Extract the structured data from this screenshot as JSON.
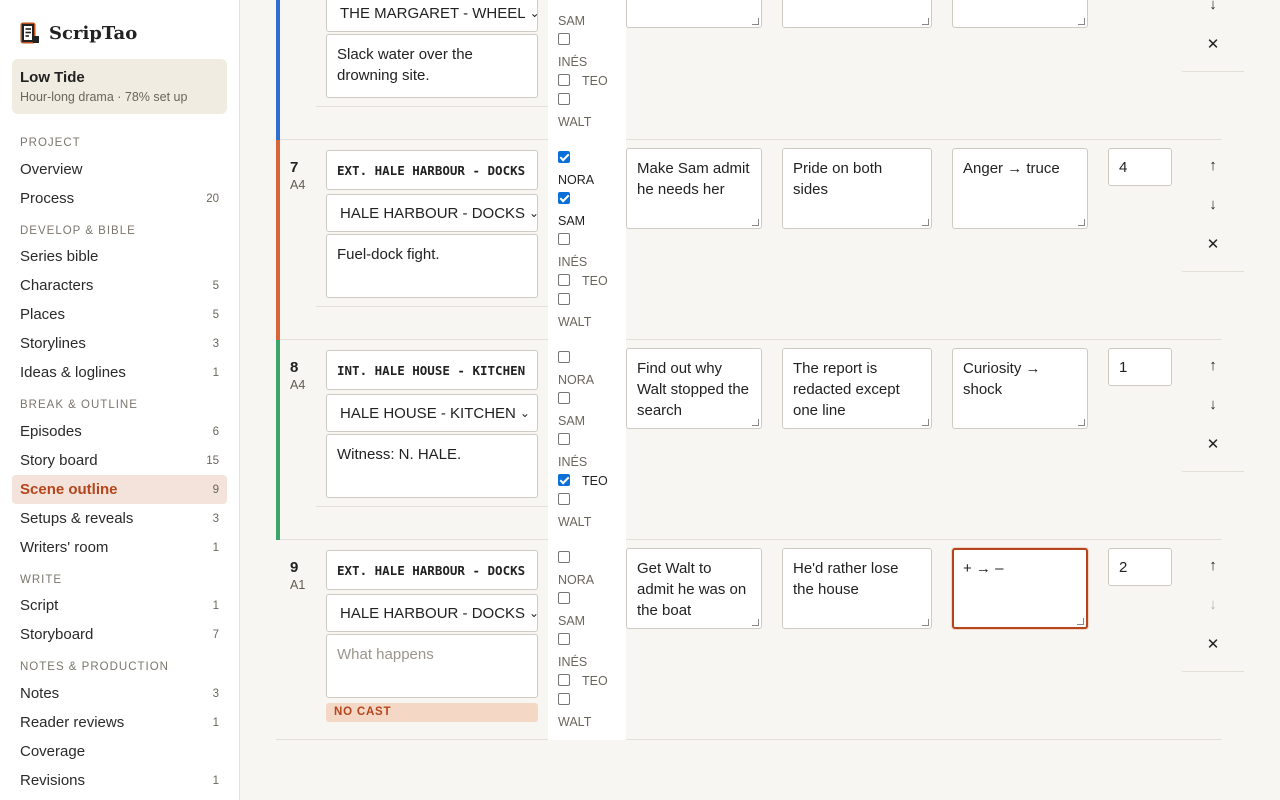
{
  "app": {
    "name": "ScripTao"
  },
  "project": {
    "title": "Low Tide",
    "subtitle": "Hour-long drama · 78% set up"
  },
  "sidebar": {
    "sections": [
      {
        "label": "PROJECT",
        "items": [
          {
            "label": "Overview",
            "count": ""
          },
          {
            "label": "Process",
            "count": "20"
          }
        ]
      },
      {
        "label": "DEVELOP & BIBLE",
        "items": [
          {
            "label": "Series bible",
            "count": ""
          },
          {
            "label": "Characters",
            "count": "5"
          },
          {
            "label": "Places",
            "count": "5"
          },
          {
            "label": "Storylines",
            "count": "3"
          },
          {
            "label": "Ideas & loglines",
            "count": "1"
          }
        ]
      },
      {
        "label": "BREAK & OUTLINE",
        "items": [
          {
            "label": "Episodes",
            "count": "6"
          },
          {
            "label": "Story board",
            "count": "15"
          },
          {
            "label": "Scene outline",
            "count": "9",
            "active": true
          },
          {
            "label": "Setups & reveals",
            "count": "3"
          },
          {
            "label": "Writers' room",
            "count": "1"
          }
        ]
      },
      {
        "label": "WRITE",
        "items": [
          {
            "label": "Script",
            "count": "1"
          },
          {
            "label": "Storyboard",
            "count": "7"
          }
        ]
      },
      {
        "label": "NOTES & PRODUCTION",
        "items": [
          {
            "label": "Notes",
            "count": "3"
          },
          {
            "label": "Reader reviews",
            "count": "1"
          },
          {
            "label": "Coverage",
            "count": ""
          },
          {
            "label": "Revisions",
            "count": "1"
          }
        ]
      }
    ]
  },
  "colors": {
    "accent": "#b4451c",
    "row6_bar": "#2f6fd0",
    "row7_bar": "#d9663a",
    "row8_bar": "#3aa66b",
    "row9_bar": "#ffffff"
  },
  "cast_names": [
    "NORA",
    "SAM",
    "INÉS",
    "TEO",
    "WALT"
  ],
  "scenes": [
    {
      "number": "",
      "episode": "",
      "slugline": "",
      "location": "THE MARGARET - WHEEL",
      "what_happens": "Slack water over the drowning site.",
      "cast": {
        "SAM": false,
        "INÉS": false,
        "TEO": false,
        "WALT": false
      },
      "goal": "",
      "conflict": "",
      "arc": "",
      "pages": ""
    },
    {
      "number": "7",
      "episode": "A4",
      "slugline": "EXT. HALE HARBOUR - DOCKS",
      "location": "HALE HARBOUR - DOCKS",
      "what_happens": "Fuel-dock fight.",
      "cast": {
        "NORA": true,
        "SAM": true,
        "INÉS": false,
        "TEO": false,
        "WALT": false
      },
      "goal": "Make Sam admit he needs her",
      "conflict": "Pride on both sides",
      "arc": "Anger → truce",
      "pages": "4"
    },
    {
      "number": "8",
      "episode": "A4",
      "slugline": "INT. HALE HOUSE - KITCHEN",
      "location": "HALE HOUSE - KITCHEN",
      "what_happens": "Witness: N. HALE.",
      "cast": {
        "NORA": false,
        "SAM": false,
        "INÉS": false,
        "TEO": true,
        "WALT": false
      },
      "goal": "Find out why Walt stopped the search",
      "conflict": "The report is redacted except one line",
      "arc": "Curiosity → shock",
      "pages": "1"
    },
    {
      "number": "9",
      "episode": "A1",
      "slugline": "EXT. HALE HARBOUR - DOCKS",
      "location": "HALE HARBOUR - DOCKS",
      "what_happens": "",
      "what_happens_placeholder": "What happens",
      "badge": "NO CAST",
      "cast": {
        "NORA": false,
        "SAM": false,
        "INÉS": false,
        "TEO": false,
        "WALT": false
      },
      "goal": "Get Walt to admit he was on the boat",
      "conflict": "He'd rather lose the house",
      "arc": "+ → –",
      "pages": "2"
    }
  ],
  "actions": {
    "up": "↑",
    "down": "↓",
    "remove": "✕"
  }
}
